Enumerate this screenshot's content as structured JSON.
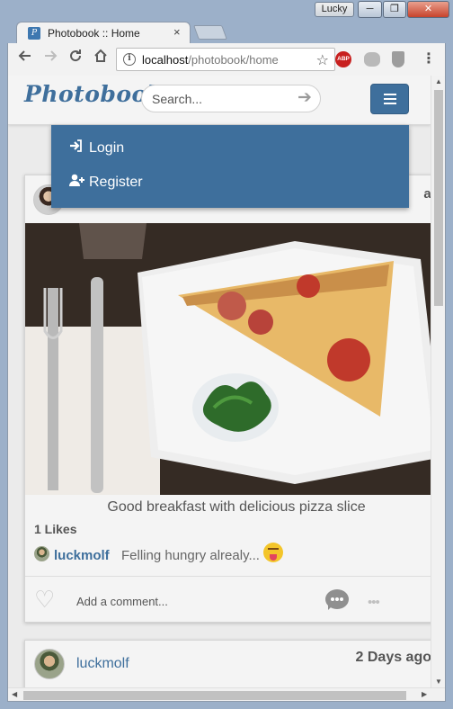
{
  "window": {
    "user_badge": "Lucky",
    "minimize_glyph": "─",
    "maximize_glyph": "❐",
    "close_glyph": "✕"
  },
  "tab": {
    "favicon": "P",
    "title": "Photobook :: Home",
    "close_glyph": "×"
  },
  "toolbar": {
    "url_host": "localhost",
    "url_path": "/photobook/home",
    "info_glyph": "i",
    "abp_label": "ABP"
  },
  "site": {
    "brand": "Photobook",
    "search_placeholder": "Search...",
    "accent_color": "#3e6f9c"
  },
  "menu": {
    "items": [
      {
        "label": "Login",
        "icon": "sign-in-icon"
      },
      {
        "label": "Register",
        "icon": "user-plus-icon"
      }
    ]
  },
  "posts": [
    {
      "time_partial": "ay",
      "caption": "Good breakfast with delicious pizza slice",
      "likes": "1 Likes",
      "comment": {
        "user": "luckmolf",
        "text": "Felling hungry alrealy...",
        "emoji": "tongue-out-emoji"
      },
      "add_comment": "Add a comment...",
      "more_label": "•••"
    },
    {
      "user": "luckmolf",
      "time": "2 Days ago"
    }
  ],
  "scroll": {
    "up": "▲",
    "down": "▼",
    "left": "◀",
    "right": "▶"
  }
}
